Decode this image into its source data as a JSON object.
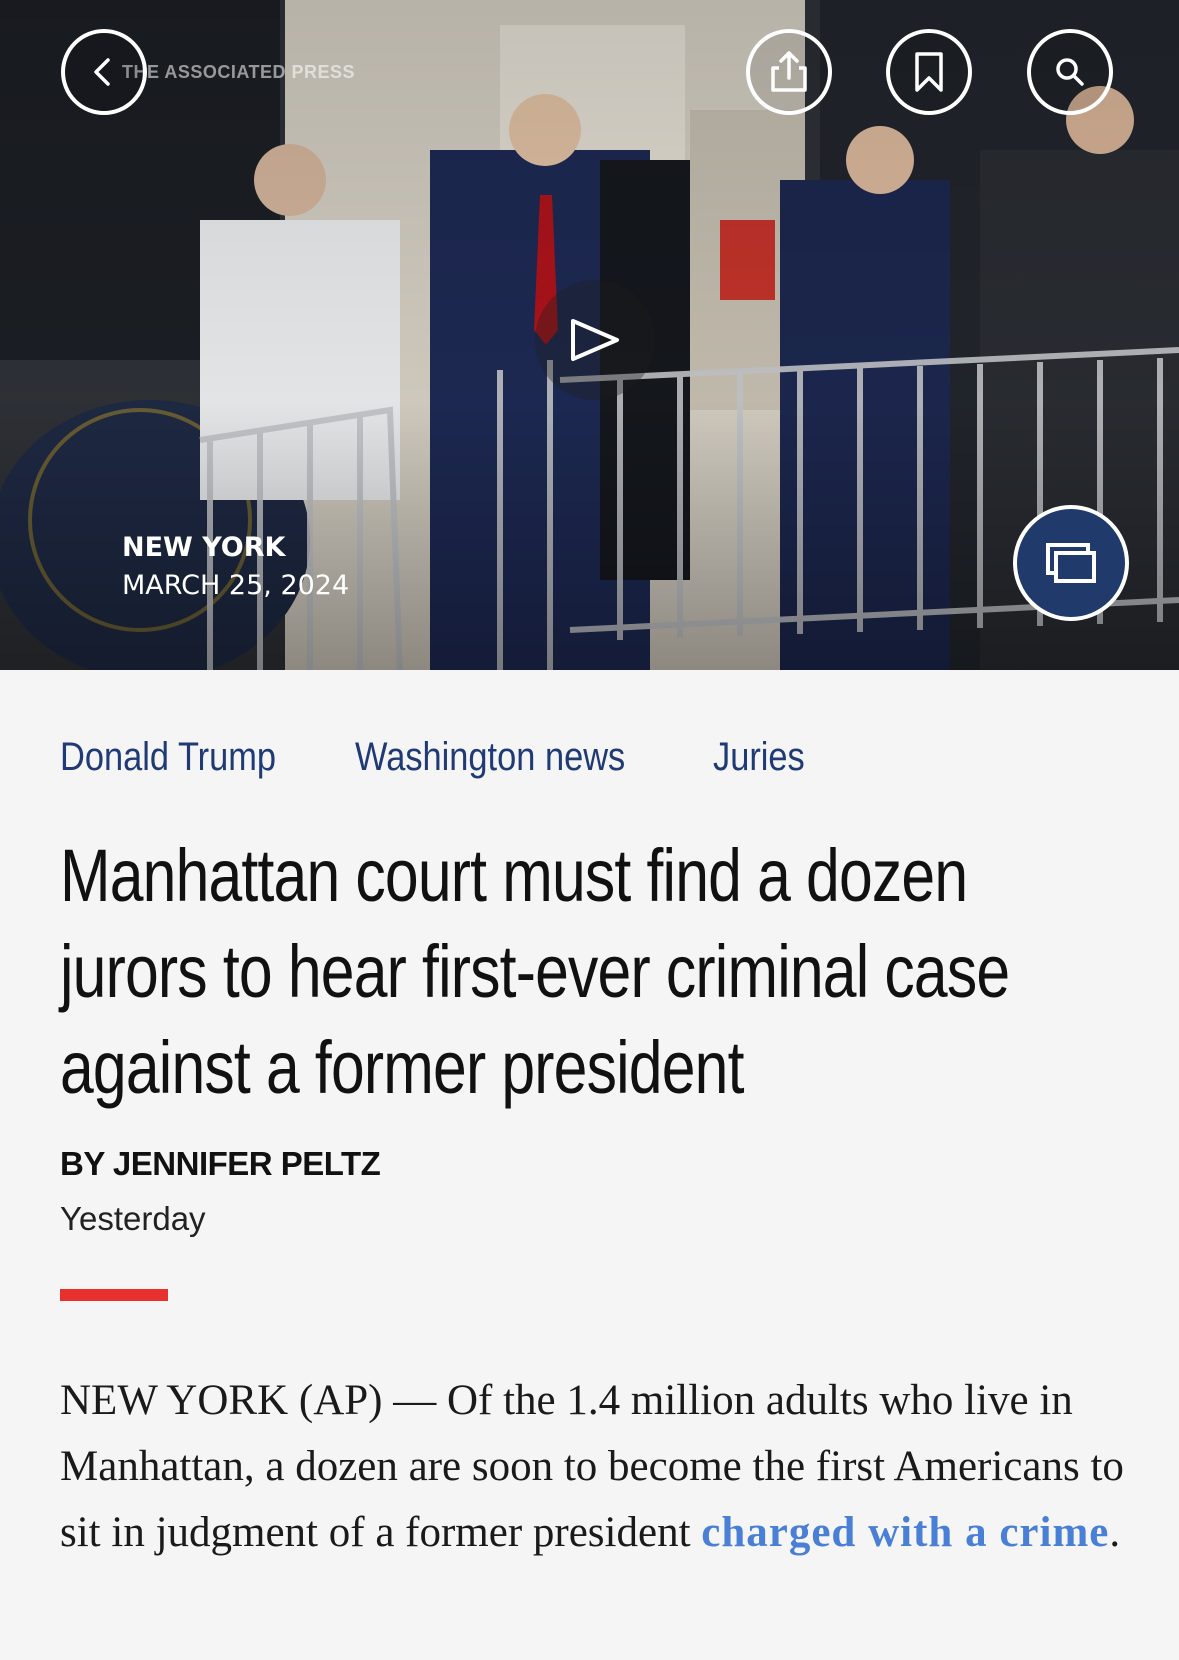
{
  "hero": {
    "watermark": "THE ASSOCIATED PRESS",
    "location": "NEW YORK",
    "date": "MARCH 25, 2024",
    "icons": {
      "back": "chevron-left-icon",
      "share": "share-icon",
      "bookmark": "bookmark-icon",
      "search": "search-icon",
      "play": "play-icon",
      "pip": "picture-in-picture-icon"
    }
  },
  "tags": [
    "Donald Trump",
    "Washington news",
    "Juries"
  ],
  "headline": {
    "lines": [
      "Manhattan court must find a dozen",
      "jurors to hear first-ever criminal case",
      "against a former president"
    ]
  },
  "byline": "BY JENNIFER PELTZ",
  "timestamp": "Yesterday",
  "body": {
    "lead": "NEW YORK (AP) — Of the 1.4 million adults who live in Manhattan, a dozen are soon to become the first Americans to sit in judgment of a former president ",
    "link_text": "charged with a crime",
    "trailing": "."
  },
  "colors": {
    "tag": "#1f3a74",
    "accent_rule": "#e8312f",
    "link": "#4a7fd6",
    "pip_button": "#1f3a6b",
    "background": "#f5f5f5"
  }
}
